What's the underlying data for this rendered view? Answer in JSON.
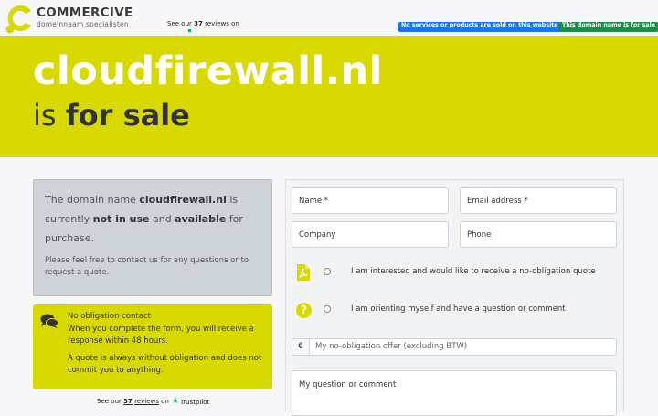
{
  "header": {
    "brand": "COMMERCIVE",
    "tagline": "domeinnaam specialisten",
    "reviews_prefix": "See our",
    "reviews_count": "37",
    "reviews_link": "reviews",
    "reviews_suffix": "on",
    "badge_no_sales": "No services or products are sold on this website.",
    "badge_for_sale": "This domain name is for sale"
  },
  "hero": {
    "domain": "cloudfirewall.nl",
    "subtitle_prefix": "is",
    "subtitle_bold": "for sale"
  },
  "info": {
    "t1": "The domain name ",
    "domain": "cloudfirewall.nl",
    "t2": " is currently ",
    "b1": "not in use",
    "t3": " and ",
    "b2": "available",
    "t4": " for purchase.",
    "help": "Please feel free to contact us for any questions or to request a quote."
  },
  "contact_card": {
    "title": "No obligation contact",
    "line1": "When you complete the form, you will receive a response within 48 hours.",
    "line2": "A quote is always without obligation and does not commit you to anything."
  },
  "footer_reviews": {
    "prefix": "See our",
    "count": "37",
    "link": "reviews",
    "suffix": "on",
    "brand": "Trustpilot"
  },
  "form": {
    "name": "Name *",
    "email": "Email address *",
    "company": "Company",
    "phone": "Phone",
    "option_quote": "I am interested and would like to receive a no-obligation quote",
    "option_question": "I am orienting myself and have a question or comment",
    "currency": "€",
    "offer_placeholder": "My no-obligation offer (excluding BTW)",
    "comment": "My question or comment"
  },
  "icons": [
    "commercive-logo-icon",
    "pdf-icon",
    "question-icon",
    "chat-icon",
    "trustpilot-star-icon"
  ],
  "colors": {
    "accent": "#d7d900",
    "badge_blue": "#1a73e8",
    "badge_green": "#1e8b49",
    "trustpilot": "#00b67a"
  }
}
